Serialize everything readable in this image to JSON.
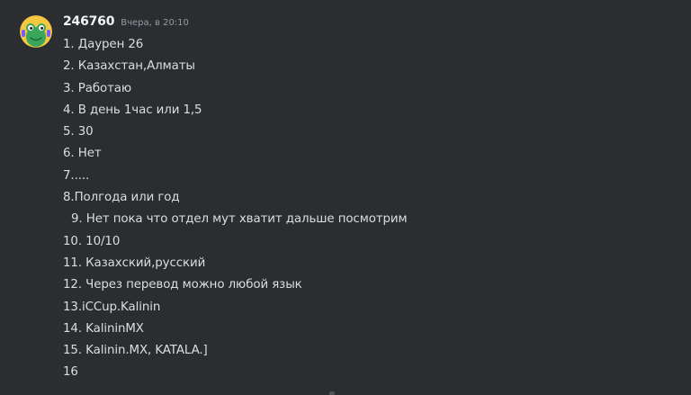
{
  "message": {
    "author": "246760",
    "timestamp": "Вчера, в 20:10",
    "lines": [
      "1. Даурен 26",
      "2. Казахстан,Алматы",
      "3. Работаю",
      "4. В день 1час или 1,5",
      "5. 30",
      "6. Нет",
      "7.....",
      "8.Полгода или год",
      "9. Нет пока что отдел мут хватит дальше посмотрим",
      "10. 10/10",
      "11. Казахский,русский",
      "12. Через перевод можно любой язык",
      "13.iCCup.Kalinin",
      "14. KalininMX",
      "15. Kalinin.MX, KATALA.]",
      "16"
    ]
  },
  "avatar_icon": "green-frog-avatar-icon",
  "colors": {
    "background": "#2c2d31",
    "text": "#dbdee1",
    "username": "#f2f3f5",
    "timestamp": "#949ba4",
    "avatar_bg": "#f5c842",
    "avatar_character": "#3ba55c"
  }
}
